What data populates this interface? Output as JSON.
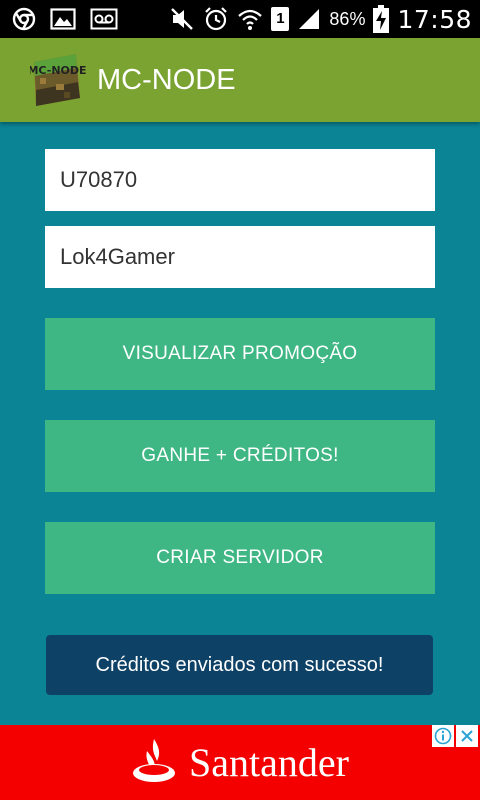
{
  "status_bar": {
    "battery_percent": "86%",
    "time": "17:58",
    "sim_slot": "1",
    "icons": [
      "chrome-icon",
      "image-icon",
      "voicemail-icon",
      "mute-icon",
      "alarm-icon",
      "wifi-icon",
      "sim-icon",
      "signal-icon",
      "battery-charging-icon"
    ]
  },
  "app_bar": {
    "title": "MC-NODE",
    "logo_text": "MC-NODE",
    "color": "#7aa331"
  },
  "form": {
    "user_id": {
      "value": "U70870"
    },
    "username": {
      "value": "Lok4Gamer"
    }
  },
  "buttons": {
    "promo_label": "VISUALIZAR PROMOÇÃO",
    "credits_label": "GANHE + CRÉDITOS!",
    "server_label": "CRIAR SERVIDOR",
    "color": "#3fb784"
  },
  "toast": {
    "message": "Créditos enviados com sucesso!"
  },
  "ad": {
    "brand": "Santander",
    "background": "#f40000",
    "icons": [
      "santander-flame-icon",
      "info-icon",
      "close-icon"
    ]
  },
  "colors": {
    "background": "#0b8496",
    "toast": "#0e4166"
  }
}
